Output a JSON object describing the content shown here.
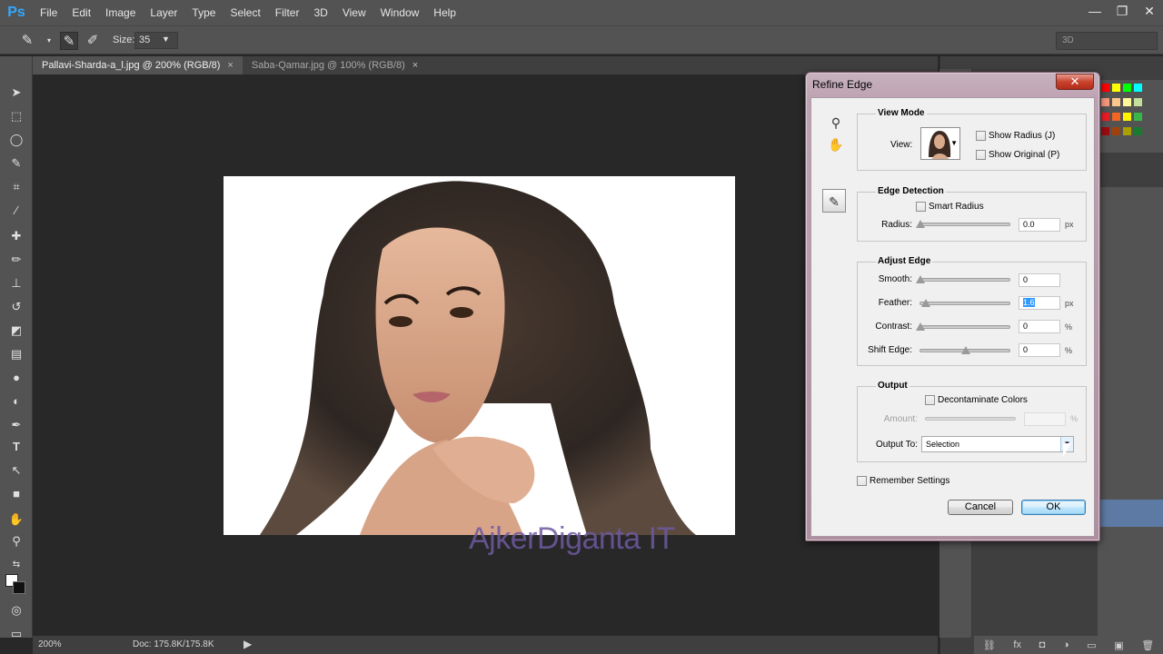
{
  "app": {
    "logo": "Ps",
    "menu": [
      "File",
      "Edit",
      "Image",
      "Layer",
      "Type",
      "Select",
      "Filter",
      "3D",
      "View",
      "Window",
      "Help"
    ],
    "window_controls": {
      "minimize": "—",
      "restore": "❐",
      "close": "✕"
    }
  },
  "options_bar": {
    "size_label": "Size:",
    "size_value": "35",
    "workspace": "3D"
  },
  "tabs": [
    {
      "label": "Pallavi-Sharda-a_l.jpg @ 200% (RGB/8)",
      "active": true,
      "close": "×"
    },
    {
      "label": "Saba-Qamar.jpg @ 100% (RGB/8)",
      "active": false,
      "close": "×"
    }
  ],
  "canvas": {
    "watermark": "AjkerDiganta IT"
  },
  "status": {
    "zoom": "200%",
    "doc": "Doc: 175.8K/175.8K",
    "arrow": "▶"
  },
  "dialog": {
    "title": "Refine Edge",
    "close": "✕",
    "view_mode": {
      "title": "View Mode",
      "view_label": "View:",
      "show_radius": "Show Radius (J)",
      "show_original": "Show Original (P)"
    },
    "edge_detection": {
      "title": "Edge Detection",
      "smart_radius": "Smart Radius",
      "radius_label": "Radius:",
      "radius_value": "0.0",
      "radius_unit": "px"
    },
    "adjust_edge": {
      "title": "Adjust Edge",
      "smooth_label": "Smooth:",
      "smooth_value": "0",
      "feather_label": "Feather:",
      "feather_value": "1.6",
      "feather_unit": "px",
      "contrast_label": "Contrast:",
      "contrast_value": "0",
      "contrast_unit": "%",
      "shift_label": "Shift Edge:",
      "shift_value": "0",
      "shift_unit": "%"
    },
    "output": {
      "title": "Output",
      "decontaminate": "Decontaminate Colors",
      "amount_label": "Amount:",
      "amount_unit": "%",
      "output_to_label": "Output To:",
      "output_to_value": "Selection"
    },
    "remember": "Remember Settings",
    "cancel": "Cancel",
    "ok": "OK"
  },
  "colors": {
    "chrome": "#535353",
    "canvas_bg": "#282828",
    "watermark": "#6e5aa0",
    "selection": "#3399ff"
  }
}
